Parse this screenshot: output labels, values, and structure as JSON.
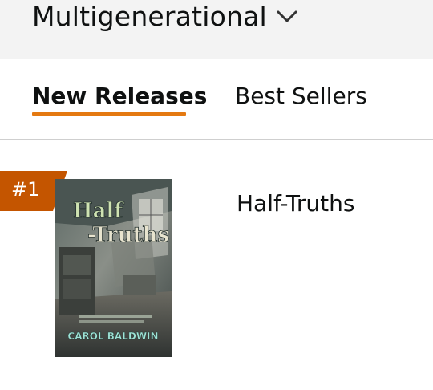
{
  "header": {
    "category_title": "Multigenerational",
    "dropdown_icon": "chevron-down-icon"
  },
  "tabs": [
    {
      "label": "New Releases",
      "selected": true
    },
    {
      "label": "Best Sellers",
      "selected": false
    }
  ],
  "colors": {
    "accent_orange": "#e47911",
    "badge_orange": "#c45500",
    "text": "#0f1111",
    "header_bg": "#f3f3f3"
  },
  "items": [
    {
      "rank": "#1",
      "title": "Half-Truths",
      "cover": {
        "title_text": "Half-Truths",
        "author_text": "CAROL BALDWIN"
      }
    }
  ]
}
